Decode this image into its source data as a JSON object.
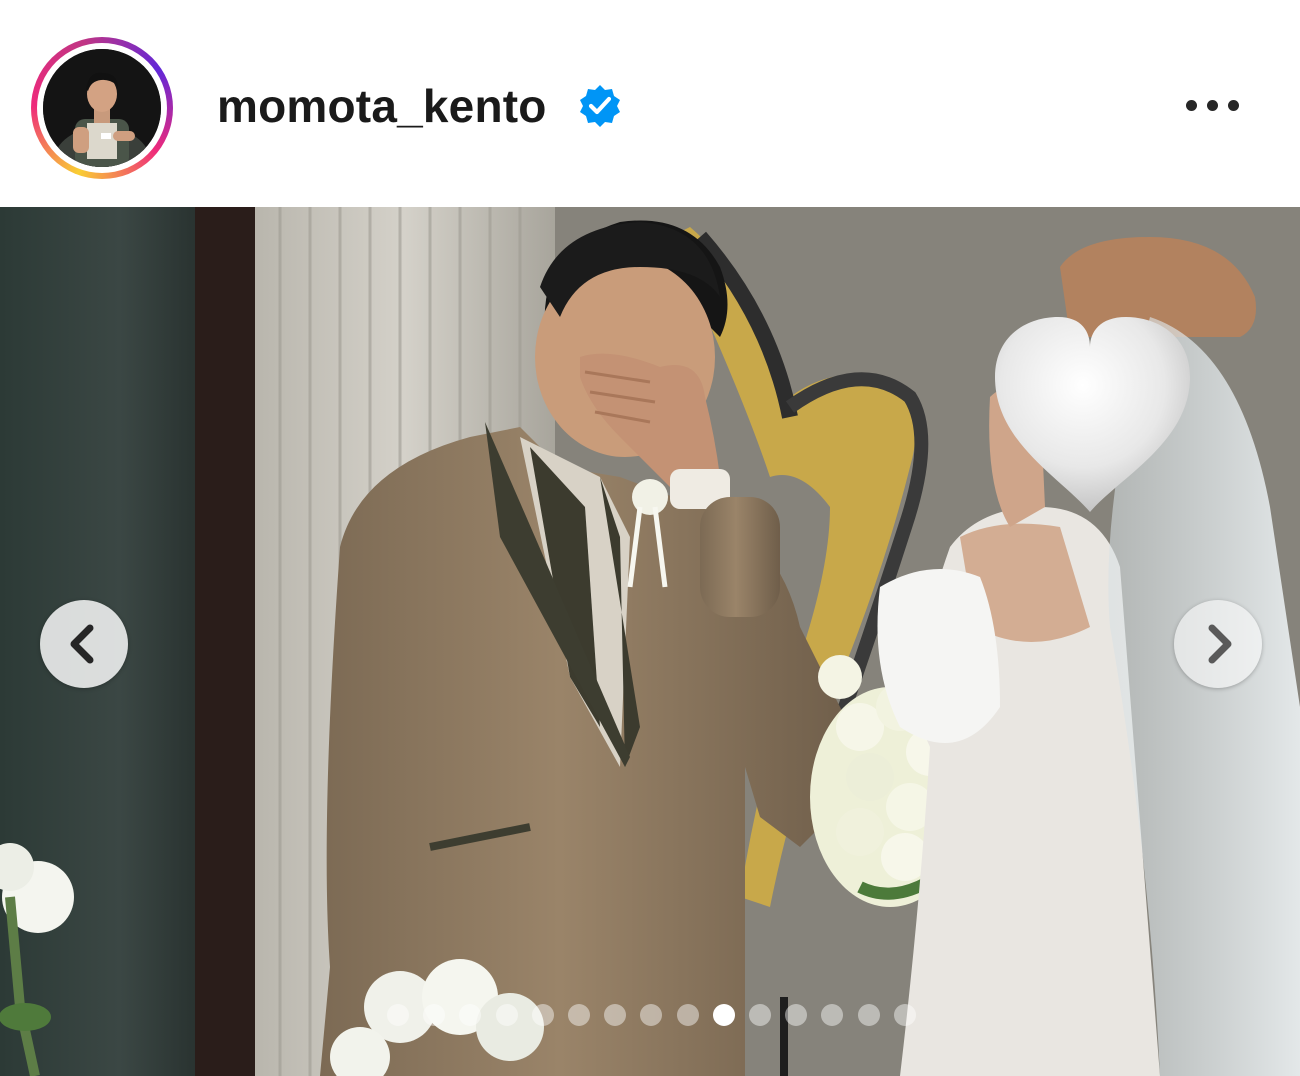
{
  "header": {
    "username": "momota_kento",
    "verified": true,
    "more_icon": "more-horizontal-icon"
  },
  "post": {
    "image_description_icon": "photo",
    "carousel": {
      "total": 15,
      "active_index": 9,
      "prev_icon": "chevron-left-icon",
      "next_icon": "chevron-right-icon"
    },
    "overlay_sticker_icon": "white-heart-icon"
  },
  "colors": {
    "verified_blue": "#0095f6",
    "text": "#1a1a1a",
    "ring_start": "#f9ce34",
    "ring_mid": "#ee2a7b",
    "ring_end": "#6228d7"
  }
}
